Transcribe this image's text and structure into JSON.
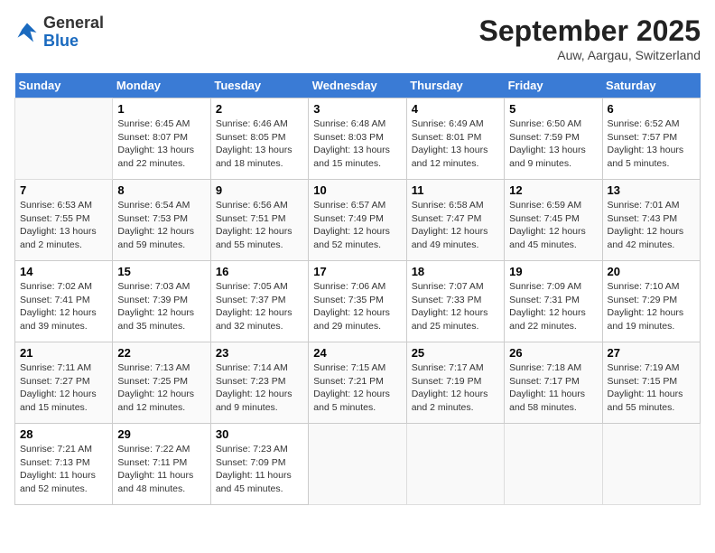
{
  "header": {
    "logo_general": "General",
    "logo_blue": "Blue",
    "month_title": "September 2025",
    "location": "Auw, Aargau, Switzerland"
  },
  "days_of_week": [
    "Sunday",
    "Monday",
    "Tuesday",
    "Wednesday",
    "Thursday",
    "Friday",
    "Saturday"
  ],
  "weeks": [
    [
      {
        "day": "",
        "info": ""
      },
      {
        "day": "1",
        "info": "Sunrise: 6:45 AM\nSunset: 8:07 PM\nDaylight: 13 hours\nand 22 minutes."
      },
      {
        "day": "2",
        "info": "Sunrise: 6:46 AM\nSunset: 8:05 PM\nDaylight: 13 hours\nand 18 minutes."
      },
      {
        "day": "3",
        "info": "Sunrise: 6:48 AM\nSunset: 8:03 PM\nDaylight: 13 hours\nand 15 minutes."
      },
      {
        "day": "4",
        "info": "Sunrise: 6:49 AM\nSunset: 8:01 PM\nDaylight: 13 hours\nand 12 minutes."
      },
      {
        "day": "5",
        "info": "Sunrise: 6:50 AM\nSunset: 7:59 PM\nDaylight: 13 hours\nand 9 minutes."
      },
      {
        "day": "6",
        "info": "Sunrise: 6:52 AM\nSunset: 7:57 PM\nDaylight: 13 hours\nand 5 minutes."
      }
    ],
    [
      {
        "day": "7",
        "info": "Sunrise: 6:53 AM\nSunset: 7:55 PM\nDaylight: 13 hours\nand 2 minutes."
      },
      {
        "day": "8",
        "info": "Sunrise: 6:54 AM\nSunset: 7:53 PM\nDaylight: 12 hours\nand 59 minutes."
      },
      {
        "day": "9",
        "info": "Sunrise: 6:56 AM\nSunset: 7:51 PM\nDaylight: 12 hours\nand 55 minutes."
      },
      {
        "day": "10",
        "info": "Sunrise: 6:57 AM\nSunset: 7:49 PM\nDaylight: 12 hours\nand 52 minutes."
      },
      {
        "day": "11",
        "info": "Sunrise: 6:58 AM\nSunset: 7:47 PM\nDaylight: 12 hours\nand 49 minutes."
      },
      {
        "day": "12",
        "info": "Sunrise: 6:59 AM\nSunset: 7:45 PM\nDaylight: 12 hours\nand 45 minutes."
      },
      {
        "day": "13",
        "info": "Sunrise: 7:01 AM\nSunset: 7:43 PM\nDaylight: 12 hours\nand 42 minutes."
      }
    ],
    [
      {
        "day": "14",
        "info": "Sunrise: 7:02 AM\nSunset: 7:41 PM\nDaylight: 12 hours\nand 39 minutes."
      },
      {
        "day": "15",
        "info": "Sunrise: 7:03 AM\nSunset: 7:39 PM\nDaylight: 12 hours\nand 35 minutes."
      },
      {
        "day": "16",
        "info": "Sunrise: 7:05 AM\nSunset: 7:37 PM\nDaylight: 12 hours\nand 32 minutes."
      },
      {
        "day": "17",
        "info": "Sunrise: 7:06 AM\nSunset: 7:35 PM\nDaylight: 12 hours\nand 29 minutes."
      },
      {
        "day": "18",
        "info": "Sunrise: 7:07 AM\nSunset: 7:33 PM\nDaylight: 12 hours\nand 25 minutes."
      },
      {
        "day": "19",
        "info": "Sunrise: 7:09 AM\nSunset: 7:31 PM\nDaylight: 12 hours\nand 22 minutes."
      },
      {
        "day": "20",
        "info": "Sunrise: 7:10 AM\nSunset: 7:29 PM\nDaylight: 12 hours\nand 19 minutes."
      }
    ],
    [
      {
        "day": "21",
        "info": "Sunrise: 7:11 AM\nSunset: 7:27 PM\nDaylight: 12 hours\nand 15 minutes."
      },
      {
        "day": "22",
        "info": "Sunrise: 7:13 AM\nSunset: 7:25 PM\nDaylight: 12 hours\nand 12 minutes."
      },
      {
        "day": "23",
        "info": "Sunrise: 7:14 AM\nSunset: 7:23 PM\nDaylight: 12 hours\nand 9 minutes."
      },
      {
        "day": "24",
        "info": "Sunrise: 7:15 AM\nSunset: 7:21 PM\nDaylight: 12 hours\nand 5 minutes."
      },
      {
        "day": "25",
        "info": "Sunrise: 7:17 AM\nSunset: 7:19 PM\nDaylight: 12 hours\nand 2 minutes."
      },
      {
        "day": "26",
        "info": "Sunrise: 7:18 AM\nSunset: 7:17 PM\nDaylight: 11 hours\nand 58 minutes."
      },
      {
        "day": "27",
        "info": "Sunrise: 7:19 AM\nSunset: 7:15 PM\nDaylight: 11 hours\nand 55 minutes."
      }
    ],
    [
      {
        "day": "28",
        "info": "Sunrise: 7:21 AM\nSunset: 7:13 PM\nDaylight: 11 hours\nand 52 minutes."
      },
      {
        "day": "29",
        "info": "Sunrise: 7:22 AM\nSunset: 7:11 PM\nDaylight: 11 hours\nand 48 minutes."
      },
      {
        "day": "30",
        "info": "Sunrise: 7:23 AM\nSunset: 7:09 PM\nDaylight: 11 hours\nand 45 minutes."
      },
      {
        "day": "",
        "info": ""
      },
      {
        "day": "",
        "info": ""
      },
      {
        "day": "",
        "info": ""
      },
      {
        "day": "",
        "info": ""
      }
    ]
  ]
}
